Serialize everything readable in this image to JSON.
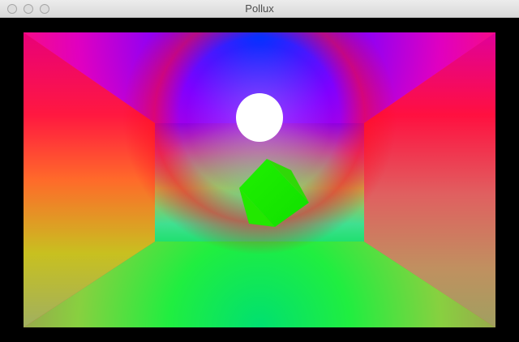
{
  "window": {
    "title": "Pollux"
  },
  "titlebar": {
    "buttons": [
      "close",
      "minimize",
      "zoom"
    ]
  },
  "scene": {
    "objects": [
      "room",
      "sphere-light",
      "cube"
    ],
    "colors": {
      "sphere": "#ffffff",
      "cube": "#22ee00",
      "floor": "#22dd44",
      "ceiling": "#2233ff",
      "walls": "#ff1a44"
    }
  }
}
